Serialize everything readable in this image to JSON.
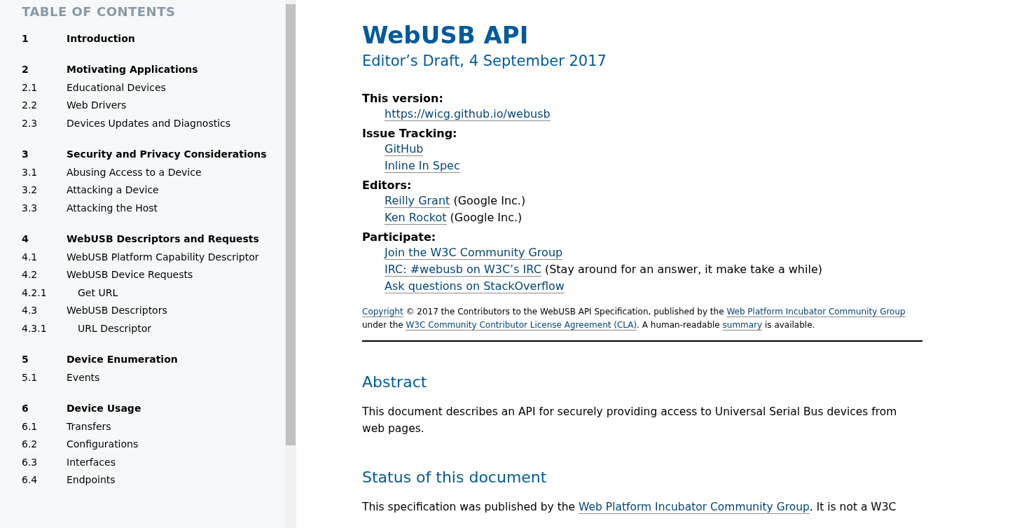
{
  "sidebar": {
    "title": "TABLE OF CONTENTS",
    "toc": [
      {
        "number": "1",
        "title": "Introduction"
      },
      {
        "number": "2",
        "title": "Motivating Applications",
        "children": [
          {
            "number": "2.1",
            "title": "Educational Devices"
          },
          {
            "number": "2.2",
            "title": "Web Drivers"
          },
          {
            "number": "2.3",
            "title": "Devices Updates and Diagnostics"
          }
        ]
      },
      {
        "number": "3",
        "title": "Security and Privacy Considerations",
        "children": [
          {
            "number": "3.1",
            "title": "Abusing Access to a Device"
          },
          {
            "number": "3.2",
            "title": "Attacking a Device"
          },
          {
            "number": "3.3",
            "title": "Attacking the Host"
          }
        ]
      },
      {
        "number": "4",
        "title": "WebUSB Descriptors and Requests",
        "children": [
          {
            "number": "4.1",
            "title": "WebUSB Platform Capability Descriptor"
          },
          {
            "number": "4.2",
            "title": "WebUSB Device Requests",
            "children": [
              {
                "number": "4.2.1",
                "title": "Get URL"
              }
            ]
          },
          {
            "number": "4.3",
            "title": "WebUSB Descriptors",
            "children": [
              {
                "number": "4.3.1",
                "title": "URL Descriptor"
              }
            ]
          }
        ]
      },
      {
        "number": "5",
        "title": "Device Enumeration",
        "children": [
          {
            "number": "5.1",
            "title": "Events"
          }
        ]
      },
      {
        "number": "6",
        "title": "Device Usage",
        "children": [
          {
            "number": "6.1",
            "title": "Transfers"
          },
          {
            "number": "6.2",
            "title": "Configurations"
          },
          {
            "number": "6.3",
            "title": "Interfaces"
          },
          {
            "number": "6.4",
            "title": "Endpoints"
          }
        ]
      }
    ]
  },
  "document": {
    "title": "WebUSB API",
    "subtitle": "Editor’s Draft, 4 September 2017",
    "metadata": [
      {
        "term": "This version:",
        "entries": [
          [
            {
              "text": "https://wicg.github.io/webusb",
              "link": true
            }
          ]
        ]
      },
      {
        "term": "Issue Tracking:",
        "entries": [
          [
            {
              "text": "GitHub",
              "link": true
            }
          ],
          [
            {
              "text": "Inline In Spec",
              "link": true
            }
          ]
        ]
      },
      {
        "term": "Editors:",
        "entries": [
          [
            {
              "text": "Reilly Grant",
              "link": true
            },
            {
              "text": " (Google Inc.)",
              "link": false
            }
          ],
          [
            {
              "text": "Ken Rockot",
              "link": true
            },
            {
              "text": " (Google Inc.)",
              "link": false
            }
          ]
        ]
      },
      {
        "term": "Participate:",
        "entries": [
          [
            {
              "text": "Join the W3C Community Group",
              "link": true
            }
          ],
          [
            {
              "text": "IRC: #webusb on W3C’s IRC",
              "link": true
            },
            {
              "text": " (Stay around for an answer, it make take a while)",
              "link": false
            }
          ],
          [
            {
              "text": "Ask questions on StackOverflow",
              "link": true
            }
          ]
        ]
      }
    ],
    "copyright": [
      {
        "text": "Copyright",
        "link": true
      },
      {
        "text": " © 2017 the Contributors to the WebUSB API Specification, published by the ",
        "link": false
      },
      {
        "text": "Web Platform Incubator Community Group",
        "link": true
      },
      {
        "text": " under the ",
        "link": false
      },
      {
        "text": "W3C Community Contributor License Agreement (CLA)",
        "link": true
      },
      {
        "text": ". A human-readable ",
        "link": false
      },
      {
        "text": "summary",
        "link": true
      },
      {
        "text": " is available.",
        "link": false
      }
    ],
    "sections": [
      {
        "heading": "Abstract",
        "paragraph": [
          {
            "text": "This document describes an API for securely providing access to Universal Serial Bus devices from web pages.",
            "link": false
          }
        ]
      },
      {
        "heading": "Status of this document",
        "paragraph": [
          {
            "text": "This specification was published by the ",
            "link": false
          },
          {
            "text": "Web Platform Incubator Community Group",
            "link": true
          },
          {
            "text": ". It is not a W3C",
            "link": false
          }
        ]
      }
    ]
  }
}
